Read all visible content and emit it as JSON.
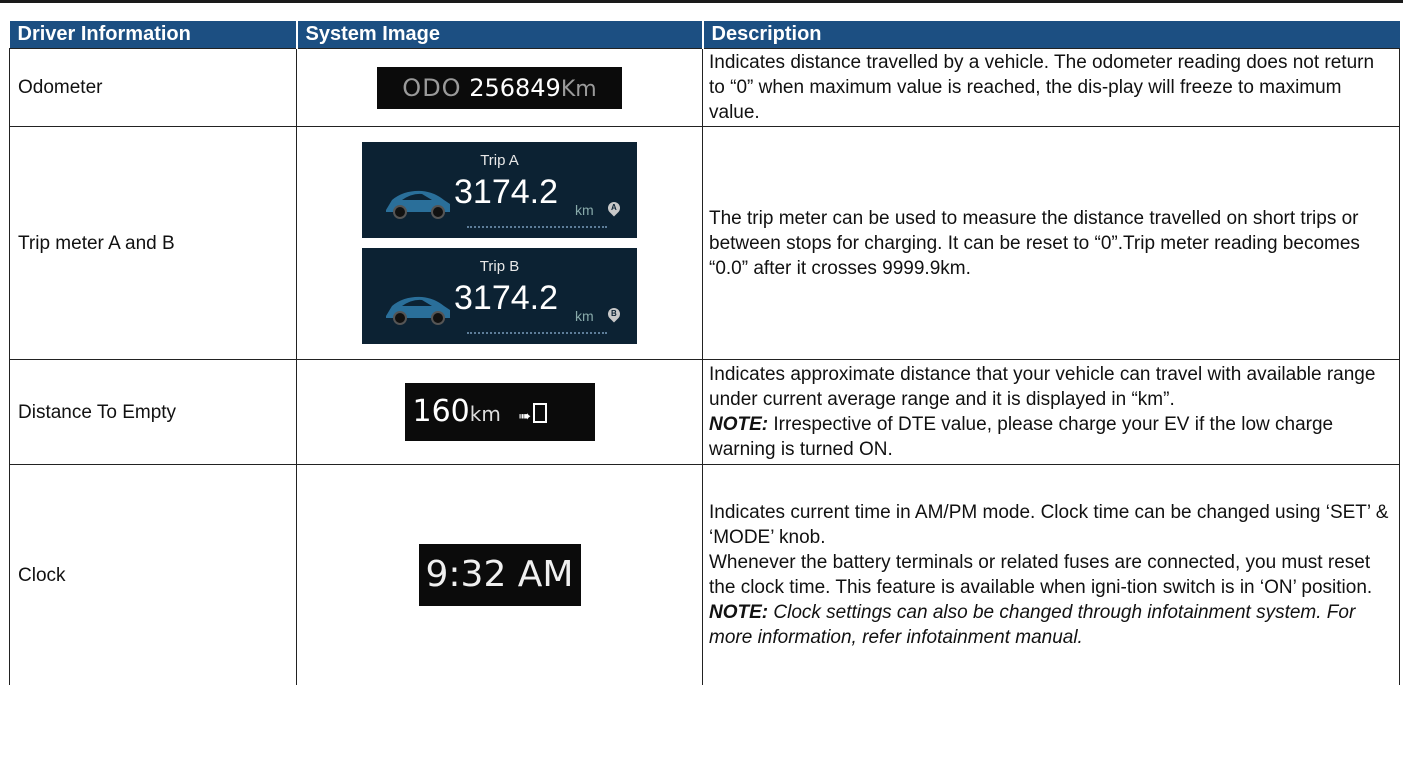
{
  "header": {
    "col1": "Driver Information",
    "col2": "System Image",
    "col3": "Description"
  },
  "rows": [
    {
      "name": "Odometer",
      "image": {
        "label": "ODO",
        "value": "256849",
        "unit": "Km"
      },
      "description": [
        "Indicates distance travelled by a vehicle. The odometer reading does not return to “0” when maximum value is reached, the dis-play will freeze to maximum value."
      ]
    },
    {
      "name": "Trip meter  A and B",
      "image": {
        "trip_a": {
          "title": "Trip A",
          "value": "3174.2",
          "unit": "km",
          "badge": "A"
        },
        "trip_b": {
          "title": "Trip B",
          "value": "3174.2",
          "unit": "km",
          "badge": "B"
        }
      },
      "description": [
        "The trip meter can be used to measure the distance travelled on short trips or between stops for charging. It can be reset to “0”.Trip meter reading becomes “0.0” after it crosses 9999.9km."
      ]
    },
    {
      "name": "Distance To Empty",
      "image": {
        "value": "160",
        "unit": "km",
        "arrow": "➠"
      },
      "description": [
        "Indicates approximate distance that your vehicle can travel with available range under current average range and it is displayed in “km”."
      ],
      "note_label": "NOTE:",
      "note_text": " Irrespective of DTE value, please charge your EV if the low charge warning is turned ON."
    },
    {
      "name": "Clock",
      "image": {
        "value": "9:32 AM"
      },
      "description": [
        "Indicates current time in AM/PM mode. Clock time can be changed using ‘SET’ & ‘MODE’ knob.",
        "Whenever the battery terminals or related fuses are connected, you must reset the clock time. This feature is available when igni-tion switch is in ‘ON’ position."
      ],
      "note_label": "NOTE:",
      "note_text": " Clock settings can also be changed through infotainment system. For more information, refer infotainment manual."
    }
  ],
  "colors": {
    "header_bg": "#1c4f82",
    "header_text": "#ffffff"
  }
}
